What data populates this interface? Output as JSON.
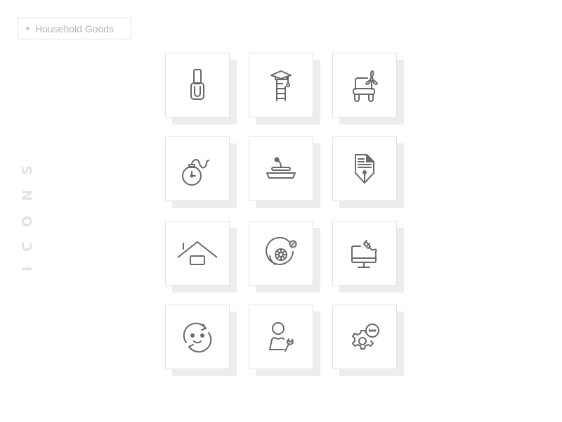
{
  "category_tag": {
    "label": "Household Goods"
  },
  "side_title": "ICONS",
  "icons": [
    {
      "name": "nail-polish-icon",
      "label": "Nail polish"
    },
    {
      "name": "graduation-ladder-icon",
      "label": "Education ladder"
    },
    {
      "name": "chair-fan-icon",
      "label": "Chair with fan"
    },
    {
      "name": "stopwatch-rope-icon",
      "label": "Pocket watch"
    },
    {
      "name": "serving-tray-icon",
      "label": "Cloche tray"
    },
    {
      "name": "document-pen-icon",
      "label": "Document pen"
    },
    {
      "name": "house-roof-icon",
      "label": "House"
    },
    {
      "name": "brake-disc-icon",
      "label": "Brake disc"
    },
    {
      "name": "monitor-plug-icon",
      "label": "Monitor with plug"
    },
    {
      "name": "face-refresh-icon",
      "label": "Face refresh"
    },
    {
      "name": "user-wrench-icon",
      "label": "User service"
    },
    {
      "name": "gear-chat-icon",
      "label": "Settings chat"
    }
  ],
  "colors": {
    "icon_stroke": "#6a6a6a",
    "card_shadow": "#ededed",
    "card_border": "#e4e4e4",
    "tag_text": "#b5b5b5",
    "side_title": "#e0e3e6"
  }
}
